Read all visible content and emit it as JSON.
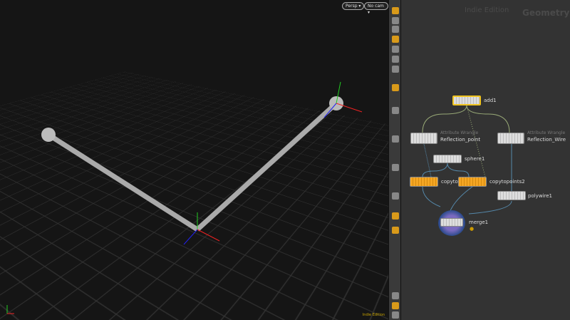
{
  "viewport": {
    "view_menu": "Persp ▾",
    "camera_menu": "No cam ▾",
    "edition": "Indie Edition"
  },
  "network": {
    "edition_watermark": "Indie Edition",
    "context_watermark": "Geometry",
    "nodes": [
      {
        "name": "add1"
      },
      {
        "type": "Attribute Wrangle",
        "name": "Reflection_point"
      },
      {
        "type": "Attribute Wrangle",
        "name": "Reflection_Wire"
      },
      {
        "name": "sphere1"
      },
      {
        "name": "copytopoints1"
      },
      {
        "name": "copytopoints2"
      },
      {
        "name": "polywire1"
      },
      {
        "name": "merge1"
      }
    ]
  },
  "colors": {
    "accent": "#d99a1a",
    "selected": "#f0c420",
    "viewport_bg": "#151515"
  }
}
